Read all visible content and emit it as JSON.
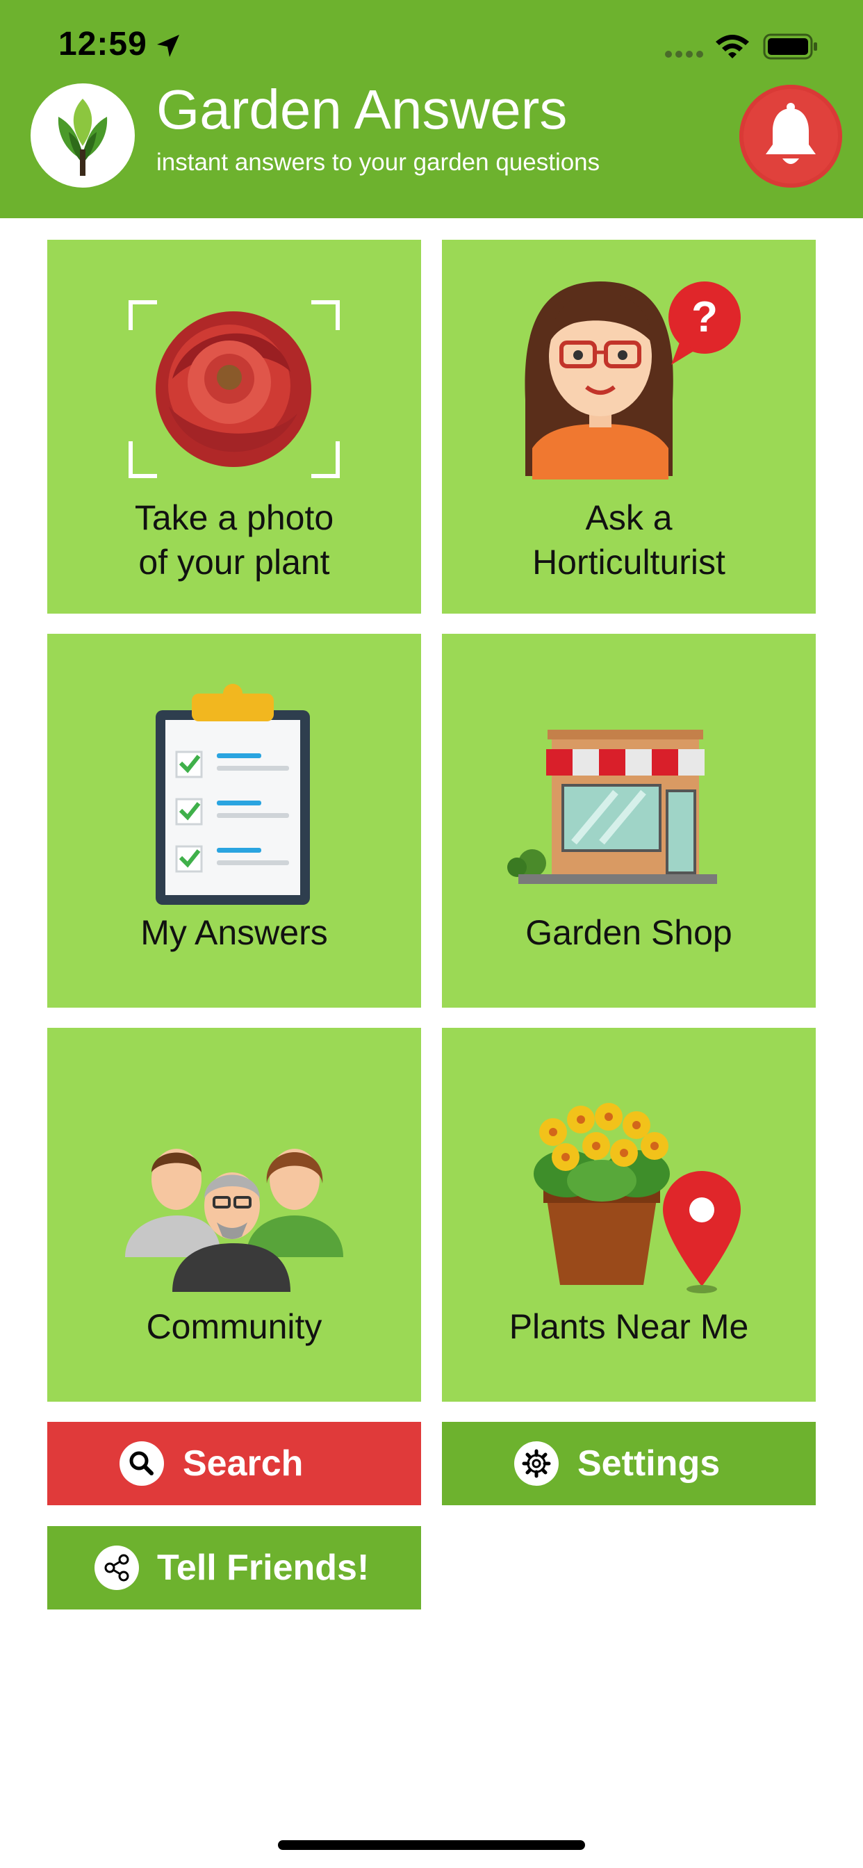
{
  "status_bar": {
    "time": "12:59"
  },
  "header": {
    "title": "Garden Answers",
    "subtitle": "instant answers to your garden questions"
  },
  "tiles": [
    {
      "lines": [
        "Take a photo",
        "of your plant"
      ]
    },
    {
      "lines": [
        "Ask a",
        "Horticulturist"
      ]
    },
    {
      "lines": [
        "My Answers"
      ]
    },
    {
      "lines": [
        "Garden Shop"
      ]
    },
    {
      "lines": [
        "Community"
      ]
    },
    {
      "lines": [
        "Plants Near Me"
      ]
    }
  ],
  "buttons": {
    "search": "Search",
    "settings": "Settings",
    "tell_friends": "Tell Friends!"
  },
  "colors": {
    "header_green": "#6db22e",
    "tile_green": "#9bd955",
    "button_green": "#6db22e",
    "search_red": "#e03a3a",
    "bell_red": "#e0413c"
  },
  "icons": {
    "header": [
      "app-logo-icon",
      "notification-bell-icon"
    ],
    "tiles": [
      "rose-camera-icon",
      "horticulturist-icon",
      "clipboard-icon",
      "storefront-icon",
      "community-people-icon",
      "potted-plant-pin-icon"
    ],
    "buttons": [
      "search-icon",
      "gear-icon",
      "share-icon"
    ]
  }
}
